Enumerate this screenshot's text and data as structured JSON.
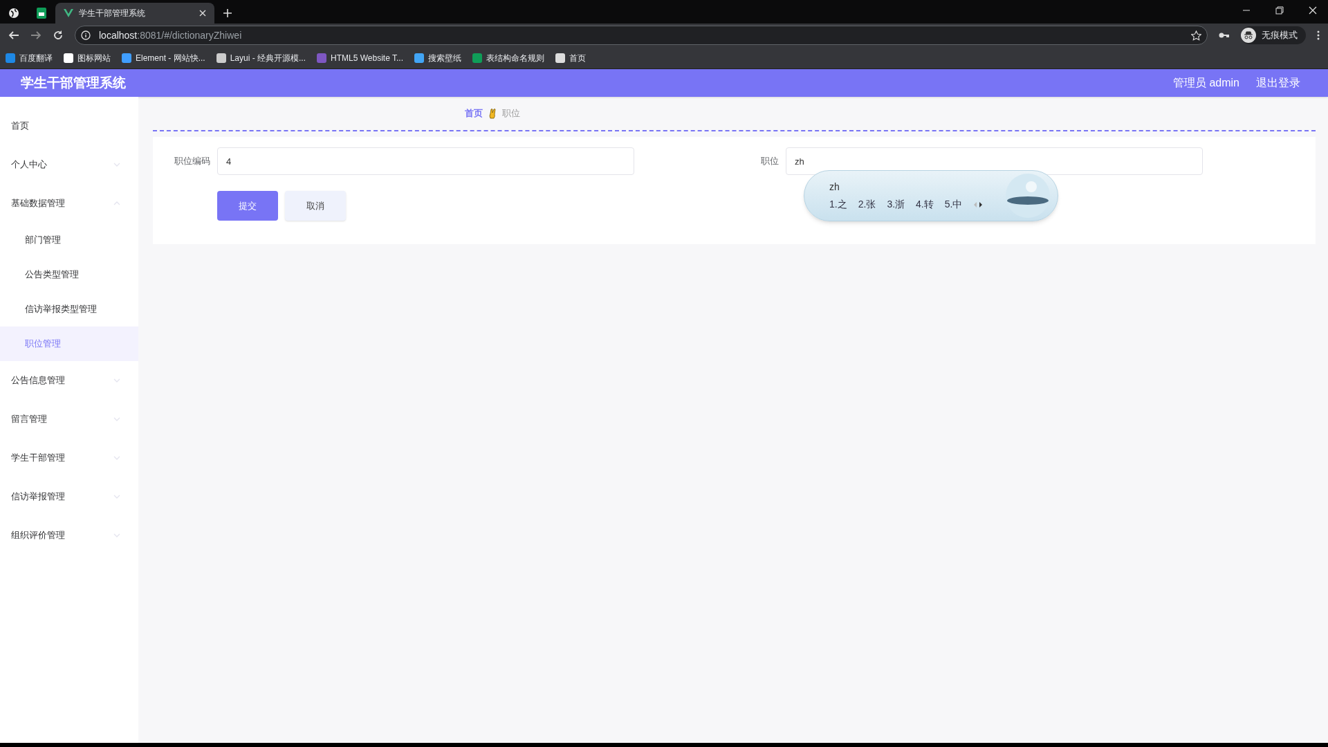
{
  "browser": {
    "tabs": [
      {
        "title": "学生干部管理系统",
        "selected": true
      }
    ],
    "address": {
      "host": "localhost",
      "path": ":8081/#/dictionaryZhiwei"
    },
    "profile": "无痕模式",
    "bookmarks": [
      {
        "label": "百度翻译",
        "color": "#1e88e5"
      },
      {
        "label": "图标网站",
        "color": "#ffffff"
      },
      {
        "label": "Element - 网站快...",
        "color": "#409eff"
      },
      {
        "label": "Layui - 经典开源模...",
        "color": "#cccccc"
      },
      {
        "label": "HTML5 Website T...",
        "color": "#7e57c2"
      },
      {
        "label": "搜索壁纸",
        "color": "#42a5f5"
      },
      {
        "label": "表结构命名规则",
        "color": "#0f9d58"
      },
      {
        "label": "首页",
        "color": "#dddddd"
      }
    ]
  },
  "app": {
    "title": "学生干部管理系统",
    "user": "管理员 admin",
    "logout": "退出登录"
  },
  "sidebar": {
    "items": [
      {
        "label": "首页",
        "selected": false
      },
      {
        "label": "个人中心",
        "selected": false,
        "expanded": false
      },
      {
        "label": "基础数据管理",
        "selected": false,
        "expanded": true,
        "children": [
          {
            "label": "部门管理",
            "selected": false
          },
          {
            "label": "公告类型管理",
            "selected": false
          },
          {
            "label": "信访举报类型管理",
            "selected": false
          },
          {
            "label": "职位管理",
            "selected": true
          }
        ]
      },
      {
        "label": "公告信息管理",
        "selected": false,
        "expanded": false
      },
      {
        "label": "留言管理",
        "selected": false,
        "expanded": false
      },
      {
        "label": "学生干部管理",
        "selected": false,
        "expanded": false
      },
      {
        "label": "信访举报管理",
        "selected": false,
        "expanded": false
      },
      {
        "label": "组织评价管理",
        "selected": false,
        "expanded": false
      }
    ]
  },
  "breadcrumb": [
    {
      "label": "首页",
      "selected": true
    },
    {
      "label": "职位",
      "selected": false
    }
  ],
  "form": {
    "fields": [
      {
        "label": "职位编码",
        "value": "4"
      },
      {
        "label": "职位",
        "value": "zh"
      }
    ],
    "buttons": [
      {
        "label": "提交",
        "kind": "primary"
      },
      {
        "label": "取消",
        "kind": "secondary"
      }
    ]
  },
  "ime": {
    "composition": "zh",
    "candidates": [
      "1.之",
      "2.张",
      "3.浙",
      "4.转",
      "5.中"
    ]
  }
}
